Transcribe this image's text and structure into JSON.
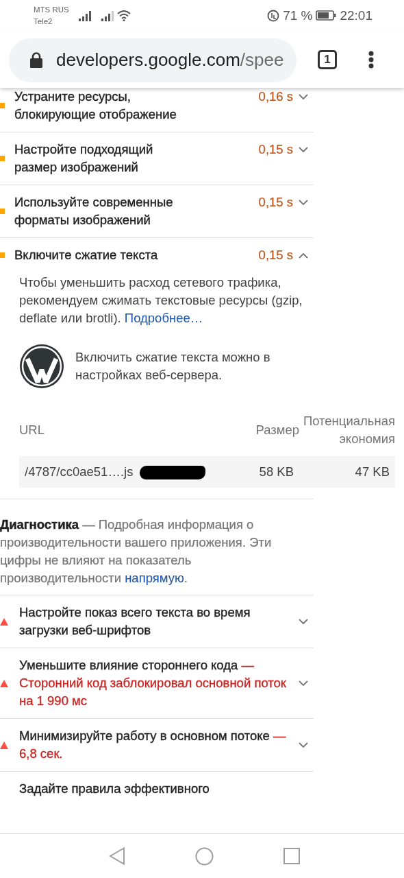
{
  "status_bar": {
    "carriers": [
      "MTS RUS",
      "Tele2"
    ],
    "battery": "71 %",
    "time": "22:01"
  },
  "address_bar": {
    "host": "developers.google.com",
    "path": "/spee",
    "tab_count": "1"
  },
  "opportunities": [
    {
      "kind": "average",
      "title": "Устраните ресурсы, блокирующие отображение",
      "savings": "0,16 s",
      "expanded": false
    },
    {
      "kind": "average",
      "title": "Настройте подходящий размер изображений",
      "savings": "0,15 s",
      "expanded": false
    },
    {
      "kind": "average",
      "title": "Используйте современные форматы изображений",
      "savings": "0,15 s",
      "expanded": false
    },
    {
      "kind": "average",
      "title": "Включите сжатие текста",
      "savings": "0,15 s",
      "expanded": true,
      "details": {
        "description": "Чтобы уменьшить расход сетевого трафика, рекомендуем сжимать текстовые ресурсы (gzip, deflate или brotli). ",
        "link": "Подробнее…",
        "stack_note": "Включить сжатие текста можно в настройках веб-сервера.",
        "table": {
          "columns": [
            "URL",
            "Размер",
            "Потенциальная экономия"
          ],
          "rows": [
            [
              "/4787/cc0ae51….js",
              "58 KB",
              "47 KB"
            ]
          ]
        }
      }
    }
  ],
  "diagnostics": {
    "description": "**Диагностика**  — Подробная информация о производительности вашего приложения. Эти цифры не влияют на показатель производительности ",
    "link": "напрямую",
    "description_end": ".",
    "items": [
      {
        "kind": "fail",
        "title": "Настройте показ всего текста во время загрузки веб-шрифтов",
        "expanded": false
      },
      {
        "kind": "fail",
        "title": "Уменьшите влияние стороннего кода",
        "display_value": "— Сторонний код заблокировал основной поток на 1 990 мс",
        "expanded": false
      },
      {
        "kind": "fail",
        "title": "Минимизируйте работу в основном потоке",
        "display_value": "— 6,8 сек.",
        "expanded": false
      },
      {
        "kind": "cut",
        "title": "Задайте правила эффективного"
      }
    ]
  }
}
